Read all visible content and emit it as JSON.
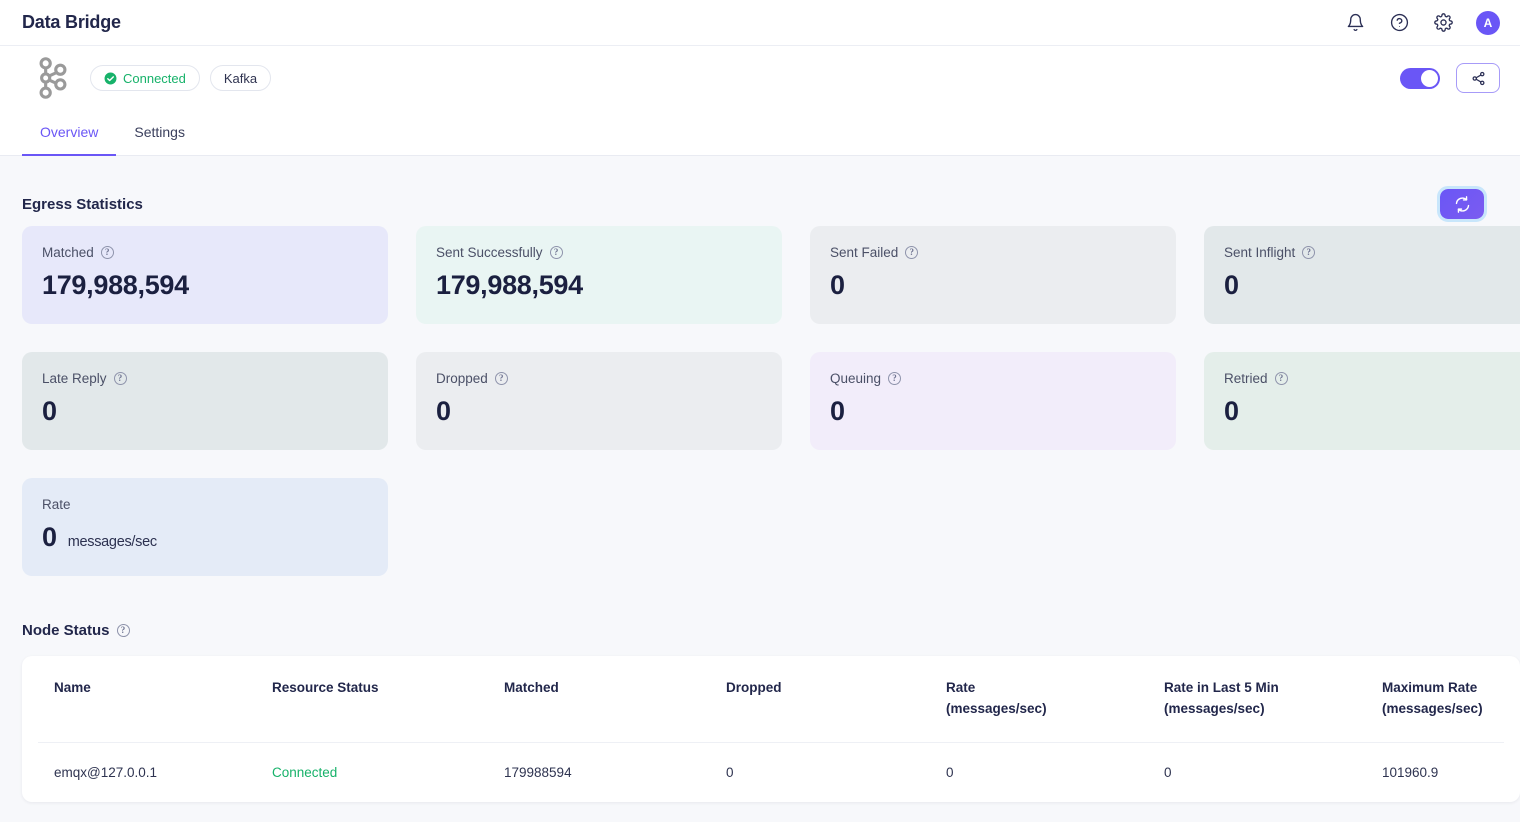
{
  "appbar": {
    "title": "Data Bridge",
    "icons": [
      "bell-icon",
      "help-circle-icon",
      "gear-icon"
    ],
    "avatar_initial": "A"
  },
  "subheader": {
    "logo": "kafka-logo",
    "status_chip": {
      "label": "Connected",
      "icon": "check-circle-icon",
      "color": "#17b26a"
    },
    "type_chip": {
      "label": "Kafka"
    },
    "toggle": {
      "state": "on",
      "color": "#6a56f6"
    },
    "share_button": {
      "icon": "share-icon"
    }
  },
  "tabs": [
    {
      "label": "Overview",
      "active": true
    },
    {
      "label": "Settings",
      "active": false
    }
  ],
  "egress": {
    "title": "Egress Statistics",
    "refresh_button": {
      "icon": "refresh-icon"
    },
    "cards": [
      {
        "label": "Matched",
        "value": "179,988,594",
        "unit": "",
        "help": true,
        "theme": "c-lavender"
      },
      {
        "label": "Sent Successfully",
        "value": "179,988,594",
        "unit": "",
        "help": true,
        "theme": "c-mint"
      },
      {
        "label": "Sent Failed",
        "value": "0",
        "unit": "",
        "help": true,
        "theme": "c-gray"
      },
      {
        "label": "Sent Inflight",
        "value": "0",
        "unit": "",
        "help": true,
        "theme": "c-slate"
      },
      {
        "label": "Late Reply",
        "value": "0",
        "unit": "",
        "help": true,
        "theme": "c-slate"
      },
      {
        "label": "Dropped",
        "value": "0",
        "unit": "",
        "help": true,
        "theme": "c-gray"
      },
      {
        "label": "Queuing",
        "value": "0",
        "unit": "",
        "help": true,
        "theme": "c-plum"
      },
      {
        "label": "Retried",
        "value": "0",
        "unit": "",
        "help": true,
        "theme": "c-green"
      },
      {
        "label": "Rate",
        "value": "0",
        "unit": "messages/sec",
        "help": false,
        "theme": "c-blue"
      }
    ]
  },
  "node_status": {
    "title": "Node Status",
    "help": true,
    "columns": [
      "Name",
      "Resource Status",
      "Matched",
      "Dropped",
      "Rate\n(messages/sec)",
      "Rate in Last 5 Min\n(messages/sec)",
      "Maximum Rate\n(messages/sec)"
    ],
    "rows": [
      {
        "name": "emqx@127.0.0.1",
        "resource_status": "Connected",
        "matched": "179988594",
        "dropped": "0",
        "rate": "0",
        "rate_last_5_min": "0",
        "maximum_rate": "101960.9"
      }
    ]
  }
}
